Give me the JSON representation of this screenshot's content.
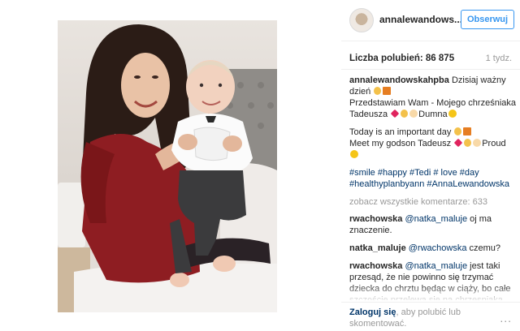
{
  "post": {
    "username": "annalewandows...",
    "follow_label": "Obserwuj",
    "likes_label": "Liczba polubień: 86 875",
    "time": "1 tydz.",
    "caption": {
      "user": "annalewandowskahpba",
      "line1": "Dzisiaj ważny dzień",
      "line2": "Przedstawiam Wam - Mojego chrześniaka Tadeusza",
      "line2_end": "Dumna",
      "en1": "Today is an important day",
      "en2": "Meet my godson Tadeusz",
      "en2_end": "Proud",
      "tags": "#smile #happy #Tedi # love #day #healthyplanbyann #AnnaLewandowska"
    },
    "view_all": "zobacz wszystkie komentarze: 633",
    "comments": [
      {
        "user": "rwachowska",
        "mention": "@natka_maluje",
        "text": "oj ma znaczenie."
      },
      {
        "user": "natka_maluje",
        "mention": "@rwachowska",
        "text": "czemu?"
      },
      {
        "user": "rwachowska",
        "mention": "@natka_maluje",
        "text": "jest taki przesąd, że nie powinno się trzymać dziecka do chrztu będąc w ciąży, bo całe szczęście przelewa sie na chrzesniaka. Niestety znam az dwa przypadki, gdzie kobiety swoje dziecko straciły. Może"
      }
    ],
    "login_link": "Zaloguj się",
    "login_text": ", aby polubić lub skomentować.",
    "more_icon": "..."
  },
  "icons": {
    "avatar": "avatar",
    "more": "more-options-icon"
  }
}
